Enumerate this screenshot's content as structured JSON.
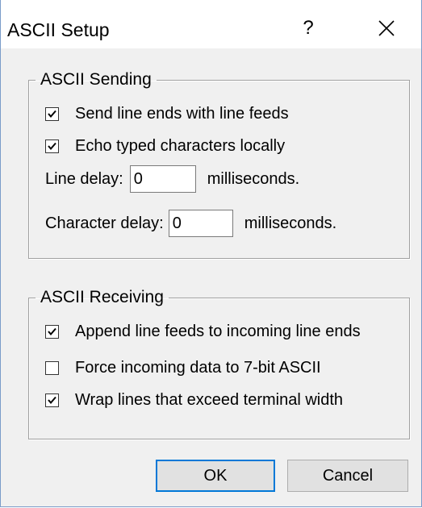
{
  "window": {
    "title": "ASCII Setup",
    "help_label": "?"
  },
  "sending": {
    "legend": "ASCII Sending",
    "send_line_ends": {
      "label": "Send line ends with line feeds",
      "checked": true
    },
    "echo_typed": {
      "label": "Echo typed characters locally",
      "checked": true
    },
    "line_delay": {
      "label": "Line delay:",
      "value": "0",
      "unit": "milliseconds."
    },
    "char_delay": {
      "label": "Character delay:",
      "value": "0",
      "unit": "milliseconds."
    }
  },
  "receiving": {
    "legend": "ASCII Receiving",
    "append_line_feeds": {
      "label": "Append line feeds to incoming line ends",
      "checked": true
    },
    "force_7bit": {
      "label": "Force incoming data to 7-bit ASCII",
      "checked": false
    },
    "wrap_lines": {
      "label": "Wrap lines that exceed terminal width",
      "checked": true
    }
  },
  "buttons": {
    "ok": "OK",
    "cancel": "Cancel"
  }
}
